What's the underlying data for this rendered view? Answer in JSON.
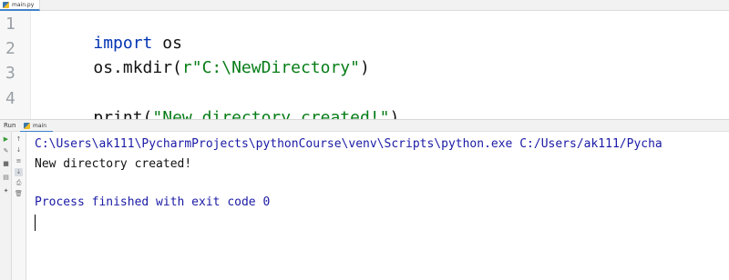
{
  "editor": {
    "tab_label": "main.py",
    "lines": [
      {
        "num": "1",
        "tokens": [
          {
            "t": "import",
            "c": "kw"
          },
          {
            "t": " os",
            "c": "fn"
          }
        ]
      },
      {
        "num": "2",
        "tokens": [
          {
            "t": "os.mkdir(",
            "c": "fn"
          },
          {
            "t": "r\"C:\\NewDirectory\"",
            "c": "str"
          },
          {
            "t": ")",
            "c": "fn"
          }
        ]
      },
      {
        "num": "3",
        "tokens": []
      },
      {
        "num": "4",
        "tokens": [
          {
            "t": "print(",
            "c": "fn"
          },
          {
            "t": "\"New directory created!\"",
            "c": "str"
          },
          {
            "t": ")",
            "c": "fn"
          }
        ]
      }
    ]
  },
  "run": {
    "title": "Run",
    "tab_label": "main"
  },
  "console": {
    "command": "C:\\Users\\ak111\\PycharmProjects\\pythonCourse\\venv\\Scripts\\python.exe C:/Users/ak111/Pycha",
    "output": "New directory created!",
    "exit_message": "Process finished with exit code 0"
  },
  "toolbar": {
    "left_icons": [
      "play-icon",
      "wrench-icon",
      "stop-icon",
      "layout-icon",
      "pin-icon"
    ],
    "right_icons": [
      "up-arrow-icon",
      "down-arrow-icon",
      "wrap-icon",
      "scroll-to-end-icon",
      "print-icon",
      "trash-icon"
    ]
  }
}
